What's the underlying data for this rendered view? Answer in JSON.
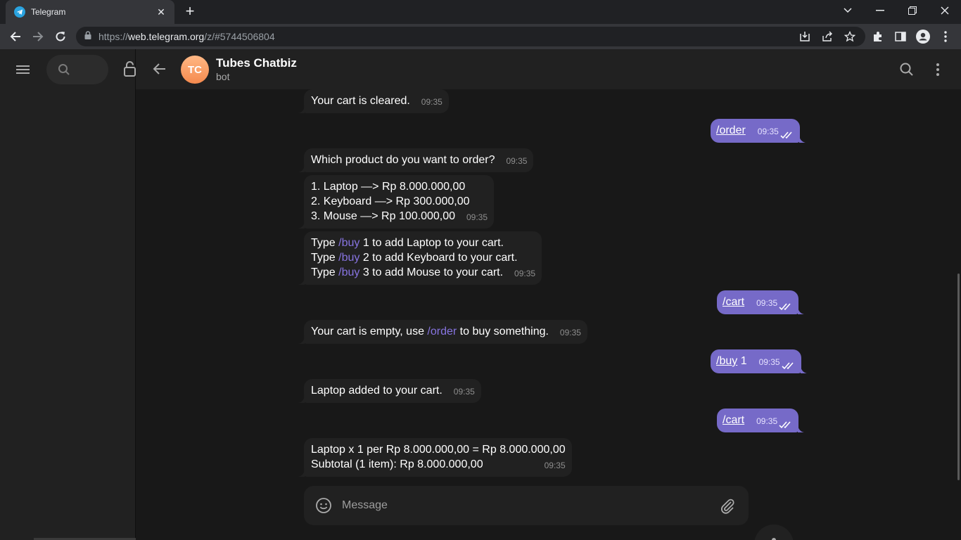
{
  "browser": {
    "tab_title": "Telegram",
    "url_prefix": "https://",
    "url_host": "web.telegram.org",
    "url_path": "/z/#5744506804"
  },
  "chat": {
    "avatar_initials": "TC",
    "title": "Tubes Chatbiz",
    "subtitle": "bot",
    "composer_placeholder": "Message"
  },
  "messages": [
    {
      "dir": "in",
      "lines": [
        [
          {
            "t": "Your cart is cleared."
          }
        ]
      ],
      "time": "09:35"
    },
    {
      "dir": "out",
      "lines": [
        [
          {
            "t": "/order",
            "cmd": true
          }
        ]
      ],
      "time": "09:35"
    },
    {
      "dir": "in",
      "lines": [
        [
          {
            "t": "Which product do you want to order?"
          }
        ]
      ],
      "time": "09:35"
    },
    {
      "dir": "in",
      "lines": [
        [
          {
            "t": "1. Laptop —> Rp 8.000.000,00"
          }
        ],
        [
          {
            "t": "2. Keyboard —> Rp 300.000,00"
          }
        ],
        [
          {
            "t": "3. Mouse —> Rp 100.000,00"
          }
        ]
      ],
      "time": "09:35"
    },
    {
      "dir": "in",
      "lines": [
        [
          {
            "t": "Type "
          },
          {
            "t": "/buy",
            "cmd": true
          },
          {
            "t": " 1 to add Laptop to your cart."
          }
        ],
        [
          {
            "t": "Type "
          },
          {
            "t": "/buy",
            "cmd": true
          },
          {
            "t": " 2 to add Keyboard to your cart."
          }
        ],
        [
          {
            "t": "Type "
          },
          {
            "t": "/buy",
            "cmd": true
          },
          {
            "t": " 3 to add Mouse to your cart."
          }
        ]
      ],
      "time": "09:35"
    },
    {
      "dir": "out",
      "lines": [
        [
          {
            "t": "/cart",
            "cmd": true
          }
        ]
      ],
      "time": "09:35"
    },
    {
      "dir": "in",
      "lines": [
        [
          {
            "t": "Your cart is empty, use "
          },
          {
            "t": "/order",
            "cmd": true
          },
          {
            "t": " to buy something."
          }
        ]
      ],
      "time": "09:35"
    },
    {
      "dir": "out",
      "lines": [
        [
          {
            "t": "/buy",
            "cmd": true
          },
          {
            "t": " 1"
          }
        ]
      ],
      "time": "09:35"
    },
    {
      "dir": "in",
      "lines": [
        [
          {
            "t": "Laptop added to your cart."
          }
        ]
      ],
      "time": "09:35"
    },
    {
      "dir": "out",
      "lines": [
        [
          {
            "t": "/cart",
            "cmd": true
          }
        ]
      ],
      "time": "09:35"
    },
    {
      "dir": "in",
      "lines": [
        [
          {
            "t": "Laptop x 1 per Rp 8.000.000,00 = Rp 8.000.000,00"
          }
        ],
        [
          {
            "t": "Subtotal (1 item): Rp 8.000.000,00"
          }
        ]
      ],
      "time": "09:35"
    }
  ]
}
